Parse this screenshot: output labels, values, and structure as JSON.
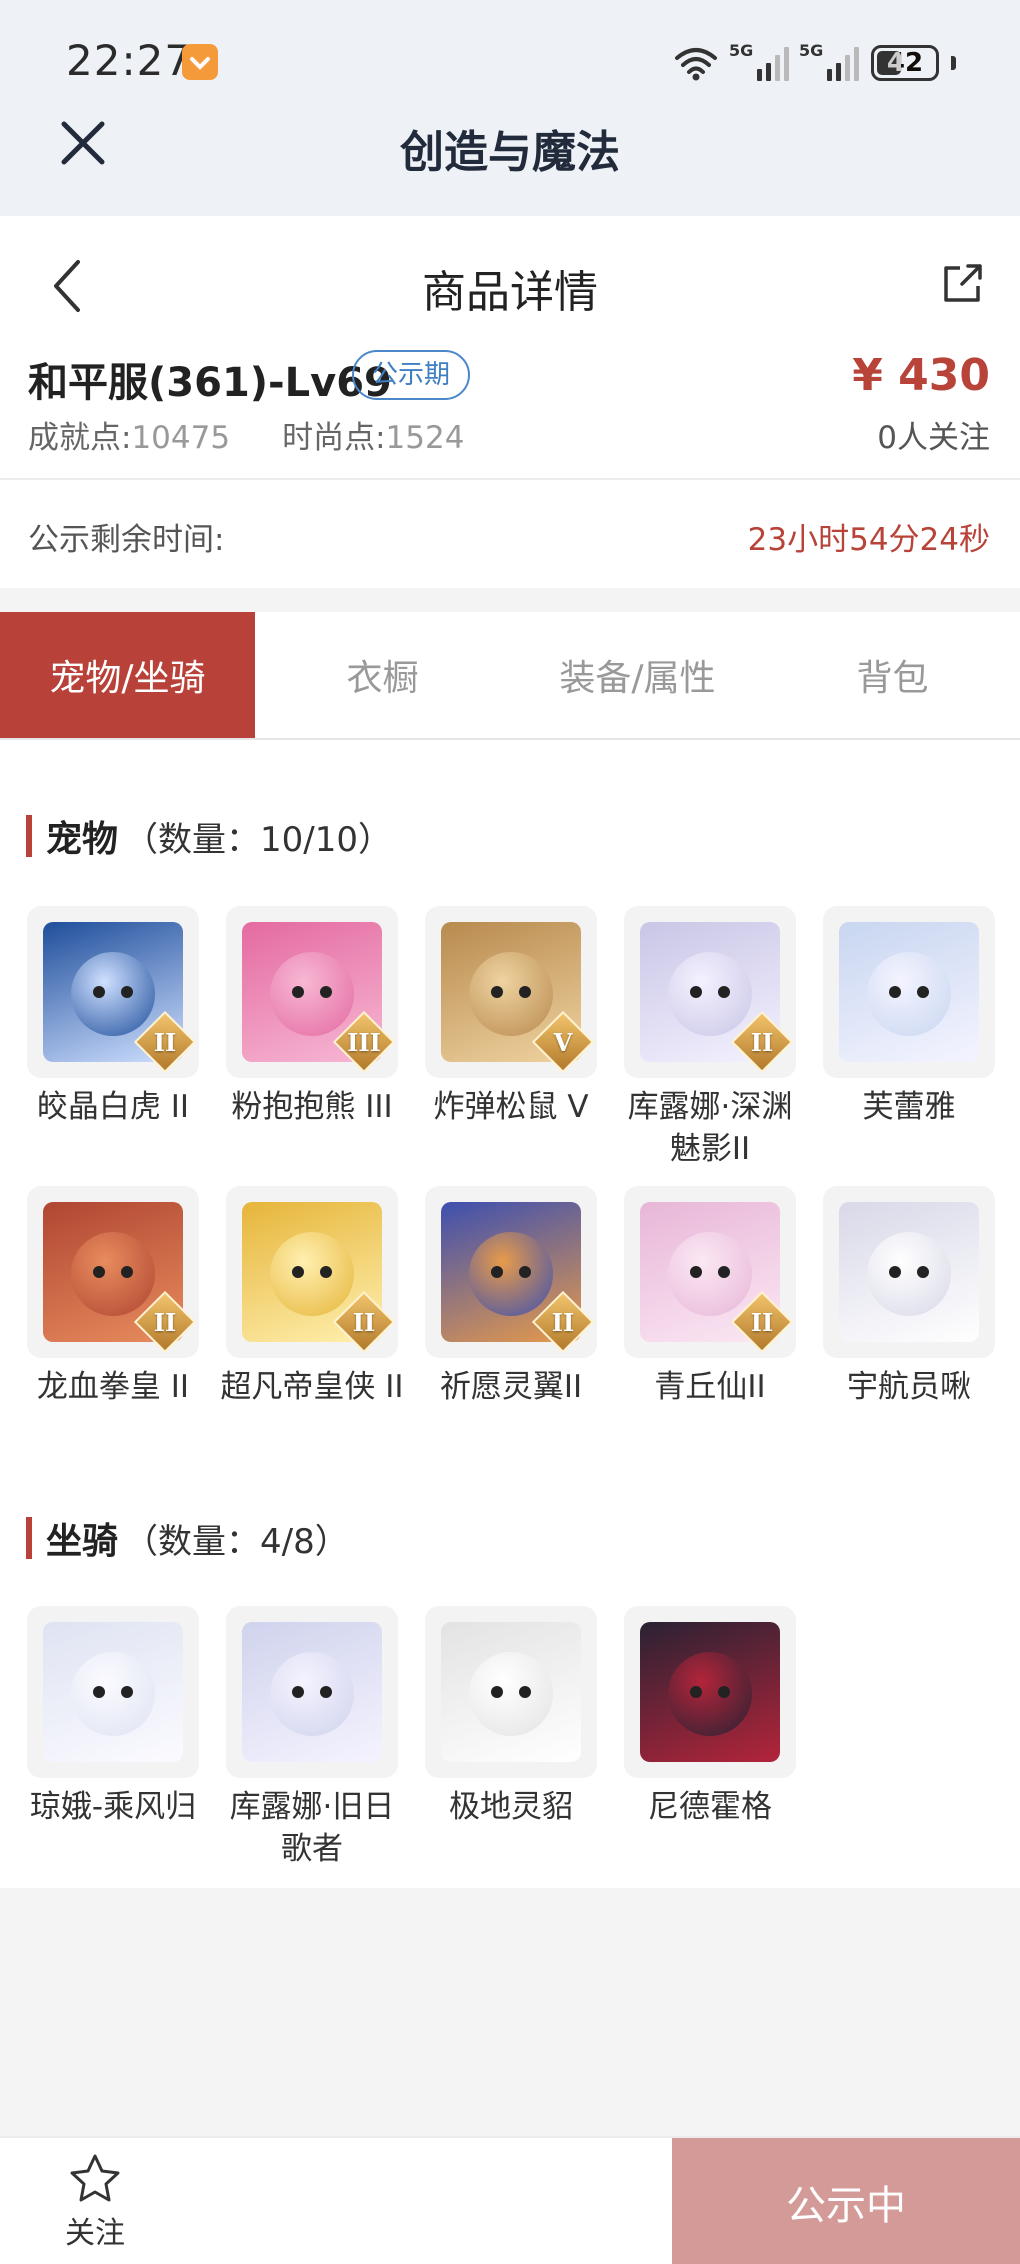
{
  "status_bar": {
    "time": "22:27",
    "net1": "5G",
    "net2": "5G",
    "battery": "42"
  },
  "app": {
    "title": "创造与魔法"
  },
  "detail": {
    "title": "商品详情"
  },
  "product": {
    "name": "和平服(361)-Lv69",
    "badge": "公示期",
    "price": "¥ 430",
    "achievement_label": "成就点:",
    "achievement_value": "10475",
    "fashion_label": "时尚点:",
    "fashion_value": "1524",
    "followers": "0人关注",
    "timer_label": "公示剩余时间:",
    "timer_value": "23小时54分24秒"
  },
  "tabs": [
    {
      "label": "宠物/坐骑",
      "active": true
    },
    {
      "label": "衣橱",
      "active": false
    },
    {
      "label": "装备/属性",
      "active": false
    },
    {
      "label": "背包",
      "active": false
    }
  ],
  "pets": {
    "title": "宠物",
    "count": "（数量：10/10）",
    "items": [
      {
        "name": "皎晶白虎 II",
        "rank": "II",
        "colors": [
          "#1f4e9b",
          "#cfe0ff"
        ]
      },
      {
        "name": "粉抱抱熊 III",
        "rank": "III",
        "colors": [
          "#e46aa0",
          "#f7b8d4"
        ]
      },
      {
        "name": "炸弹松鼠 V",
        "rank": "V",
        "colors": [
          "#b88a4f",
          "#efd3a0"
        ]
      },
      {
        "name": "库露娜·深渊魅影II",
        "rank": "II",
        "colors": [
          "#c9c6e6",
          "#f4f1ff"
        ]
      },
      {
        "name": "芙蕾雅",
        "rank": "",
        "colors": [
          "#c8d6f0",
          "#f4f4ff"
        ]
      },
      {
        "name": "龙血拳皇 II",
        "rank": "II",
        "colors": [
          "#b04632",
          "#e88c5e"
        ]
      },
      {
        "name": "超凡帝皇侠 II",
        "rank": "II",
        "colors": [
          "#e6b53a",
          "#fff0b0"
        ]
      },
      {
        "name": "祈愿灵翼II",
        "rank": "II",
        "colors": [
          "#3d4fb0",
          "#e79b4a"
        ]
      },
      {
        "name": "青丘仙II",
        "rank": "II",
        "colors": [
          "#e8b6d8",
          "#fbe8f3"
        ]
      },
      {
        "name": "宇航员啾",
        "rank": "",
        "colors": [
          "#d8d8e8",
          "#ffffff"
        ]
      }
    ]
  },
  "mounts": {
    "title": "坐骑",
    "count": "（数量：4/8）",
    "items": [
      {
        "name": "琼娥-乘风归",
        "rank": "",
        "colors": [
          "#dfe3f2",
          "#fbfbff"
        ]
      },
      {
        "name": "库露娜·旧日歌者",
        "rank": "",
        "colors": [
          "#cfd3ec",
          "#f5f3ff"
        ]
      },
      {
        "name": "极地灵貂",
        "rank": "",
        "colors": [
          "#e3e3e3",
          "#ffffff"
        ]
      },
      {
        "name": "尼德霍格",
        "rank": "",
        "colors": [
          "#2a2233",
          "#b3243a"
        ]
      }
    ]
  },
  "bottom": {
    "follow_label": "关注",
    "status_button": "公示中"
  }
}
